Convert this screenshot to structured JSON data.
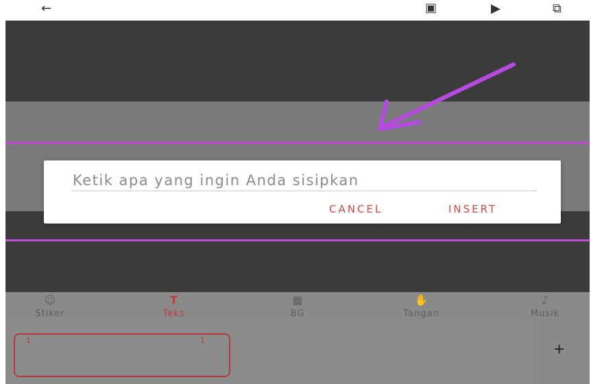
{
  "colors": {
    "accent": "#c84a4a",
    "guide_line": "#c04bd8",
    "arrow": "#b54be0"
  },
  "topbar": {
    "icons": [
      "back-arrow-icon",
      "save-icon",
      "play-icon",
      "share-icon"
    ]
  },
  "dialog": {
    "placeholder": "Ketik apa yang ingin Anda sisipkan",
    "value": "",
    "cancel_label": "CANCEL",
    "insert_label": "INSERT"
  },
  "tabs": [
    {
      "label": "Stiker",
      "icon": "sticker-icon",
      "active": false
    },
    {
      "label": "Teks",
      "icon": "text-icon",
      "active": true
    },
    {
      "label": "BG",
      "icon": "image-icon",
      "active": false
    },
    {
      "label": "Tangan",
      "icon": "hand-icon",
      "active": false
    },
    {
      "label": "Musik",
      "icon": "music-note-icon",
      "active": false
    }
  ],
  "timeline": {
    "clip_start_mark": "1",
    "clip_end_mark": "1",
    "add_label": "+"
  }
}
